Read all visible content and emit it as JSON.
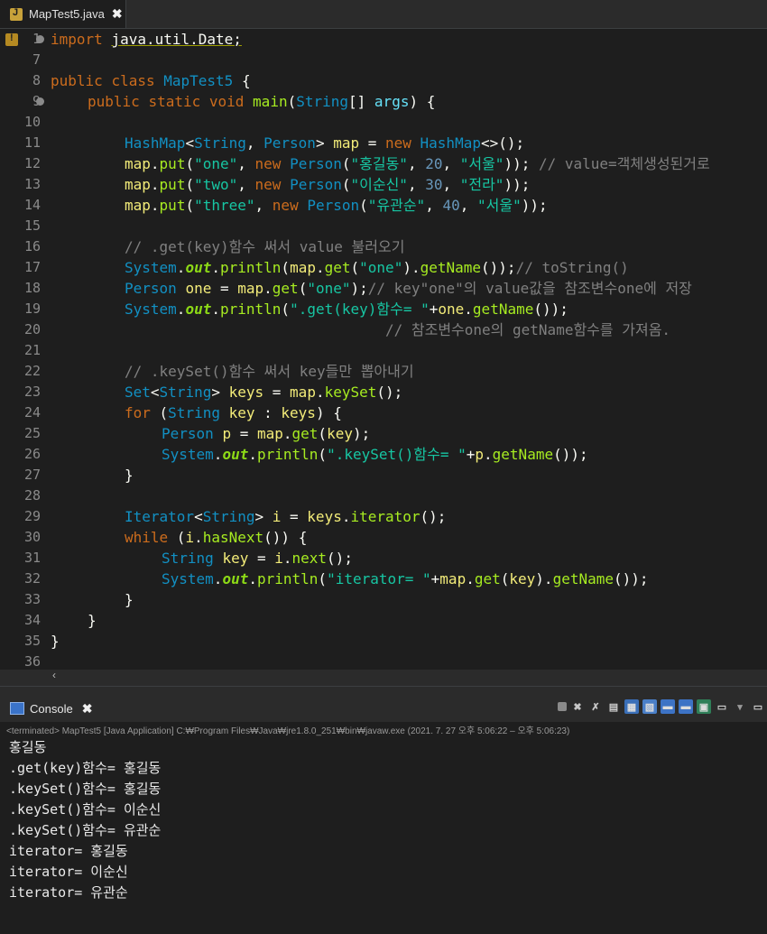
{
  "editor_tab": {
    "label": "MapTest5.java",
    "close": "✖"
  },
  "gutter": {
    "line_numbers": [
      "1",
      "7",
      "8",
      "9",
      "10",
      "11",
      "12",
      "13",
      "14",
      "15",
      "16",
      "17",
      "18",
      "19",
      "20",
      "21",
      "22",
      "23",
      "24",
      "25",
      "26",
      "27",
      "28",
      "29",
      "30",
      "31",
      "32",
      "33",
      "34",
      "35",
      "36"
    ]
  },
  "code": {
    "l1": {
      "a": "import ",
      "b": "java.util.Date;"
    },
    "l8": {
      "a": "public ",
      "b": "class ",
      "c": "MapTest5 ",
      "d": "{"
    },
    "l9": {
      "a": "public ",
      "b": "static ",
      "c": "void ",
      "d": "main",
      "e": "(",
      "f": "String",
      "g": "[] ",
      "h": "args",
      "i": ") {"
    },
    "l11": {
      "a": "HashMap",
      "b": "<",
      "c": "String",
      "d": ", ",
      "e": "Person",
      "f": "> ",
      "g": "map ",
      "h": "= ",
      "i": "new ",
      "j": "HashMap",
      "k": "<>();"
    },
    "l12": {
      "a": "map",
      "b": ".",
      "c": "put",
      "d": "(",
      "e": "\"one\"",
      "f": ", ",
      "g": "new ",
      "h": "Person",
      "i": "(",
      "j": "\"홍길동\"",
      "k": ", ",
      "l": "20",
      "m": ", ",
      "n": "\"서울\"",
      "o": ")); ",
      "p": "// value=객체생성된거로"
    },
    "l13": {
      "a": "map",
      "b": ".",
      "c": "put",
      "d": "(",
      "e": "\"two\"",
      "f": ", ",
      "g": "new ",
      "h": "Person",
      "i": "(",
      "j": "\"이순신\"",
      "k": ", ",
      "l": "30",
      "m": ", ",
      "n": "\"전라\"",
      "o": "));"
    },
    "l14": {
      "a": "map",
      "b": ".",
      "c": "put",
      "d": "(",
      "e": "\"three\"",
      "f": ", ",
      "g": "new ",
      "h": "Person",
      "i": "(",
      "j": "\"유관순\"",
      "k": ", ",
      "l": "40",
      "m": ", ",
      "n": "\"서울\"",
      "o": "));"
    },
    "l16": {
      "a": "// .get(key)함수 써서 value 불러오기"
    },
    "l17": {
      "a": "System",
      "b": ".",
      "c": "out",
      "d": ".",
      "e": "println",
      "f": "(",
      "g": "map",
      "h": ".",
      "i": "get",
      "j": "(",
      "k": "\"one\"",
      "l": ").",
      "m": "getName",
      "n": "());",
      "o": "// toString()"
    },
    "l18": {
      "a": "Person ",
      "b": "one ",
      "c": "= ",
      "d": "map",
      "e": ".",
      "f": "get",
      "g": "(",
      "h": "\"one\"",
      "i": ");",
      "j": "// key\"one\"의 value값을 참조변수one에 저장"
    },
    "l19": {
      "a": "System",
      "b": ".",
      "c": "out",
      "d": ".",
      "e": "println",
      "f": "(",
      "g": "\".get(key)함수= \"",
      "h": "+",
      "i": "one",
      "j": ".",
      "k": "getName",
      "l": "());"
    },
    "l20": {
      "a": "// 참조변수one의 getName함수를 가져옴."
    },
    "l22": {
      "a": "// .keySet()함수 써서 key들만 뽑아내기"
    },
    "l23": {
      "a": "Set",
      "b": "<",
      "c": "String",
      "d": "> ",
      "e": "keys ",
      "f": "= ",
      "g": "map",
      "h": ".",
      "i": "keySet",
      "j": "();"
    },
    "l24": {
      "a": "for ",
      "b": "(",
      "c": "String ",
      "d": "key ",
      "e": ": ",
      "f": "keys",
      "g": ") {"
    },
    "l25": {
      "a": "Person ",
      "b": "p ",
      "c": "= ",
      "d": "map",
      "e": ".",
      "f": "get",
      "g": "(",
      "h": "key",
      "i": ");"
    },
    "l26": {
      "a": "System",
      "b": ".",
      "c": "out",
      "d": ".",
      "e": "println",
      "f": "(",
      "g": "\".keySet()함수= \"",
      "h": "+",
      "i": "p",
      "j": ".",
      "k": "getName",
      "l": "());"
    },
    "l27": {
      "a": "}"
    },
    "l29": {
      "a": "Iterator",
      "b": "<",
      "c": "String",
      "d": "> ",
      "e": "i ",
      "f": "= ",
      "g": "keys",
      "h": ".",
      "i": "iterator",
      "j": "();"
    },
    "l30": {
      "a": "while ",
      "b": "(",
      "c": "i",
      "d": ".",
      "e": "hasNext",
      "f": "()) {"
    },
    "l31": {
      "a": "String ",
      "b": "key ",
      "c": "= ",
      "d": "i",
      "e": ".",
      "f": "next",
      "g": "();"
    },
    "l32": {
      "a": "System",
      "b": ".",
      "c": "out",
      "d": ".",
      "e": "println",
      "f": "(",
      "g": "\"iterator= \"",
      "h": "+",
      "i": "map",
      "j": ".",
      "k": "get",
      "l": "(",
      "m": "key",
      "n": ").",
      "o": "getName",
      "p": "());"
    },
    "l33": {
      "a": "}"
    },
    "l34": {
      "a": "}"
    },
    "l35": {
      "a": "}"
    }
  },
  "hscroll": {
    "left_arrow": "‹"
  },
  "console_tab": {
    "label": "Console",
    "close": "✖"
  },
  "console": {
    "terminated": "<terminated> MapTest5 [Java Application] C:₩Program Files₩Java₩jre1.8.0_251₩bin₩javaw.exe  (2021. 7. 27 오후 5:06:22 – 오후 5:06:23)",
    "output": [
      "홍길동",
      ".get(key)함수= 홍길동",
      ".keySet()함수= 홍길동",
      ".keySet()함수= 이순신",
      ".keySet()함수= 유관순",
      "iterator= 홍길동",
      "iterator= 이순신",
      "iterator= 유관순"
    ]
  }
}
